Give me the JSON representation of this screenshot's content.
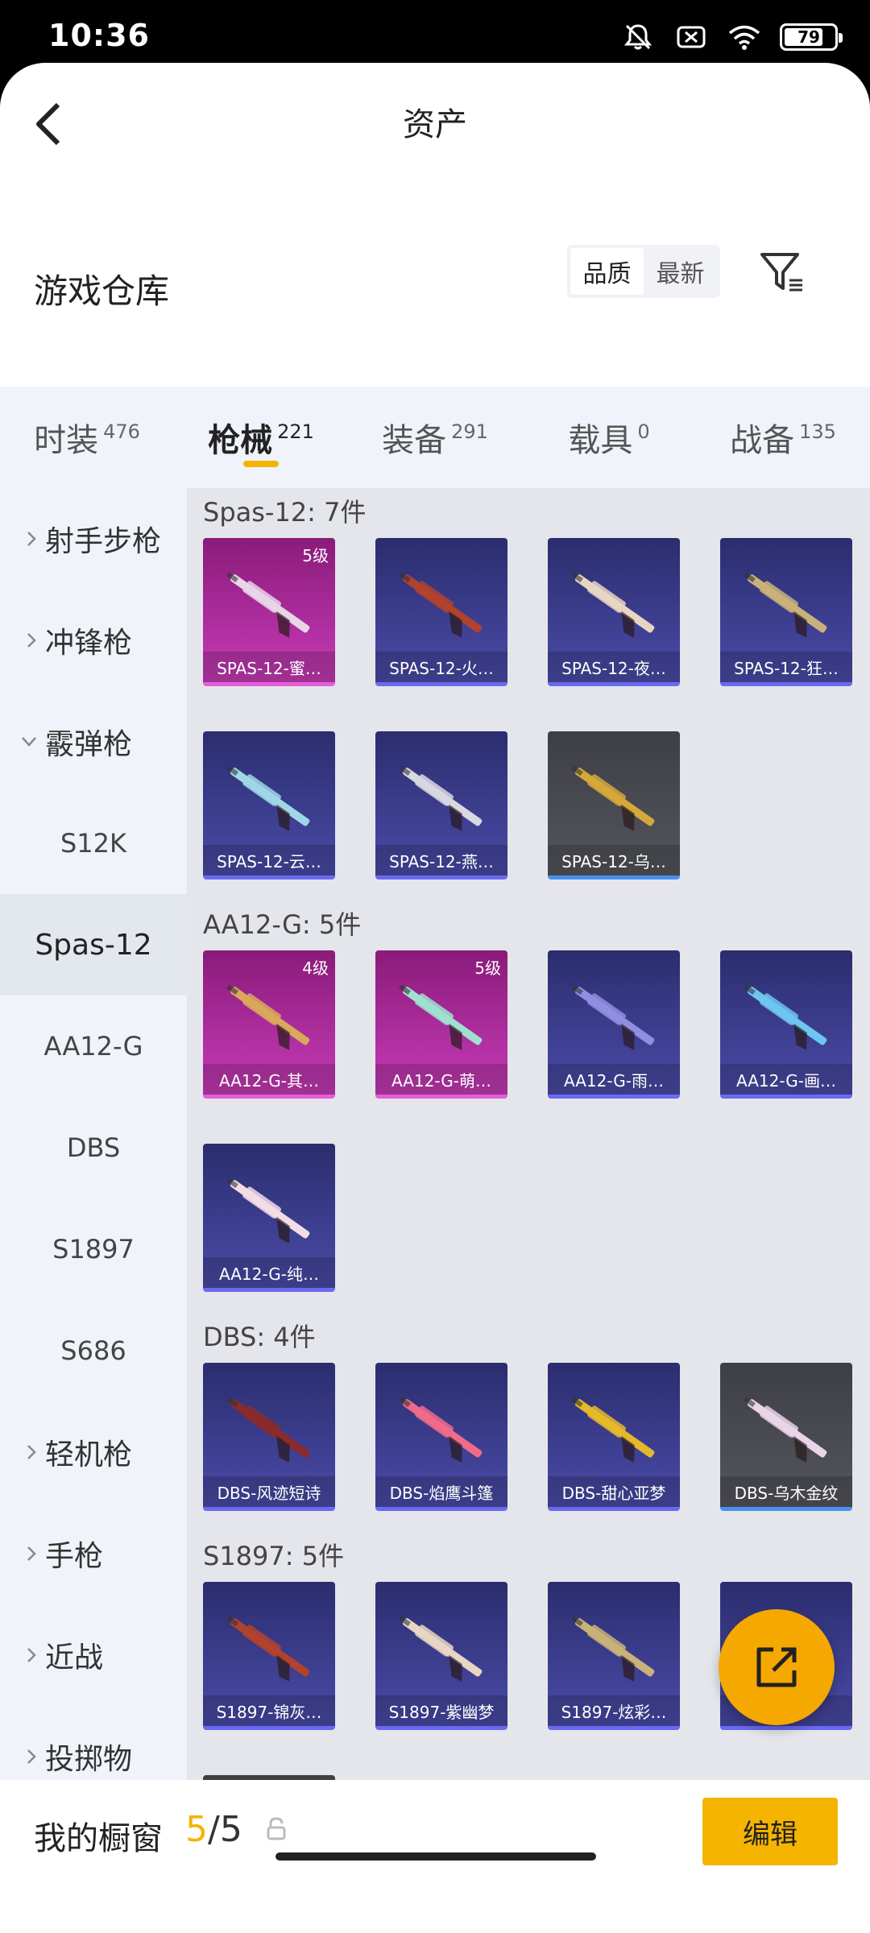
{
  "status_bar": {
    "time": "10:36",
    "battery": "79",
    "battery_level": 0.79
  },
  "header": {
    "title": "资产"
  },
  "section": {
    "title": "游戏仓库",
    "sort_options": [
      "品质",
      "最新"
    ],
    "sort_active": "品质"
  },
  "tabs": [
    {
      "label": "时装",
      "count": "476"
    },
    {
      "label": "枪械",
      "count": "221",
      "active": true
    },
    {
      "label": "装备",
      "count": "291"
    },
    {
      "label": "载具",
      "count": "0"
    },
    {
      "label": "战备",
      "count": "135"
    }
  ],
  "sidebar": {
    "items": [
      {
        "label": "射手步枪",
        "type": "category",
        "expanded": false
      },
      {
        "label": "冲锋枪",
        "type": "category",
        "expanded": false
      },
      {
        "label": "霰弹枪",
        "type": "category",
        "expanded": true
      },
      {
        "label": "S12K",
        "type": "sub"
      },
      {
        "label": "Spas-12",
        "type": "sub",
        "active": true
      },
      {
        "label": "AA12-G",
        "type": "sub"
      },
      {
        "label": "DBS",
        "type": "sub"
      },
      {
        "label": "S1897",
        "type": "sub"
      },
      {
        "label": "S686",
        "type": "sub"
      },
      {
        "label": "轻机枪",
        "type": "category",
        "expanded": false
      },
      {
        "label": "手枪",
        "type": "category",
        "expanded": false
      },
      {
        "label": "近战",
        "type": "category",
        "expanded": false
      },
      {
        "label": "投掷物",
        "type": "category",
        "expanded": false
      }
    ]
  },
  "groups": [
    {
      "title": "Spas-12: 7件",
      "items": [
        {
          "name": "SPAS-12-蜜…",
          "level": "5级",
          "tier": "pink"
        },
        {
          "name": "SPAS-12-火…",
          "tier": "purple"
        },
        {
          "name": "SPAS-12-夜…",
          "tier": "purple"
        },
        {
          "name": "SPAS-12-狂…",
          "tier": "purple"
        },
        {
          "name": "SPAS-12-云…",
          "tier": "purple"
        },
        {
          "name": "SPAS-12-燕…",
          "tier": "purple"
        },
        {
          "name": "SPAS-12-乌…",
          "tier": "gray"
        }
      ]
    },
    {
      "title": "AA12-G: 5件",
      "items": [
        {
          "name": "AA12-G-其…",
          "level": "4级",
          "tier": "pink"
        },
        {
          "name": "AA12-G-萌…",
          "level": "5级",
          "tier": "pink"
        },
        {
          "name": "AA12-G-雨…",
          "tier": "purple"
        },
        {
          "name": "AA12-G-画…",
          "tier": "purple"
        },
        {
          "name": "AA12-G-纯…",
          "tier": "purple"
        }
      ]
    },
    {
      "title": "DBS: 4件",
      "items": [
        {
          "name": "DBS-风迹短诗",
          "tier": "purple"
        },
        {
          "name": "DBS-焰鹰斗篷",
          "tier": "purple"
        },
        {
          "name": "DBS-甜心亚梦",
          "tier": "purple"
        },
        {
          "name": "DBS-乌木金纹",
          "tier": "gray"
        }
      ]
    },
    {
      "title": "S1897: 5件",
      "items": [
        {
          "name": "S1897-锦灰…",
          "tier": "purple"
        },
        {
          "name": "S1897-紫幽梦",
          "tier": "purple"
        },
        {
          "name": "S1897-炫彩…",
          "tier": "purple"
        },
        {
          "name": "",
          "tier": "purple"
        },
        {
          "name": "",
          "tier": "gray"
        }
      ]
    }
  ],
  "bottom_bar": {
    "label": "我的橱窗",
    "current": "5",
    "total": "/5",
    "edit_label": "编辑"
  },
  "colors": {
    "accent": "#f5b400",
    "pink_tier": "#c63bb7",
    "purple_tier": "#4a4ba8",
    "gray_tier": "#54565d"
  },
  "icons": [
    "back-icon",
    "filter-icon",
    "chevron-right-icon",
    "chevron-down-icon",
    "share-icon",
    "lock-icon",
    "mute-icon",
    "wifi-icon"
  ]
}
